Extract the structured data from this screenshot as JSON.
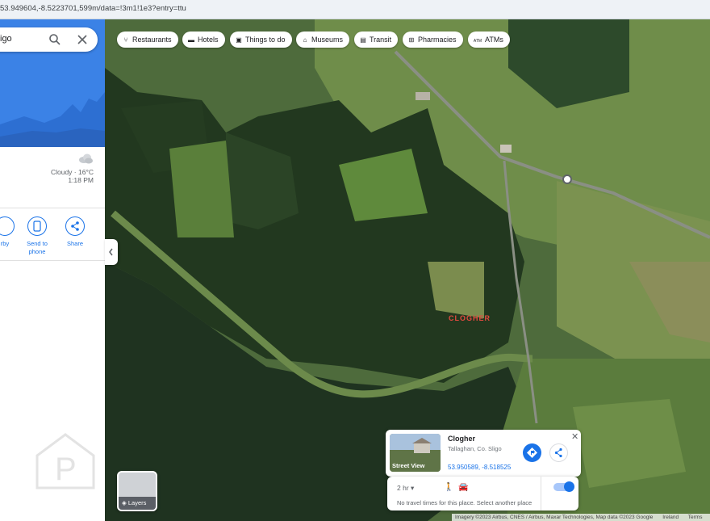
{
  "browser": {
    "url": "53.949604,-8.5223701,599m/data=!3m1!1e3?entry=ttu"
  },
  "panel": {
    "search_query": "igo",
    "weather": {
      "condition": "Cloudy",
      "temperature": "16°C",
      "time": "1:18 PM",
      "icon": "cloud-icon"
    },
    "actions": [
      {
        "label": "rby",
        "icon": "nearby-icon"
      },
      {
        "label": "Send to phone",
        "icon": "send-to-phone-icon"
      },
      {
        "label": "Share",
        "icon": "share-icon"
      }
    ]
  },
  "chips": [
    {
      "label": "Restaurants",
      "icon": "restaurant-icon"
    },
    {
      "label": "Hotels",
      "icon": "hotel-icon"
    },
    {
      "label": "Things to do",
      "icon": "camera-icon"
    },
    {
      "label": "Museums",
      "icon": "museum-icon"
    },
    {
      "label": "Transit",
      "icon": "transit-icon"
    },
    {
      "label": "Pharmacies",
      "icon": "pharmacy-icon"
    },
    {
      "label": "ATMs",
      "icon": "atm-icon"
    }
  ],
  "map": {
    "place_label": "CLOGHER",
    "layers_label": "Layers"
  },
  "card": {
    "title": "Clogher",
    "subtitle": "Tallaghan, Co. Sligo",
    "coords": "53.950589, -8.518525",
    "street_view": "Street View"
  },
  "travel": {
    "duration": "2 hr",
    "message": "No travel times for this place. Select another place"
  },
  "footer": {
    "attribution": "Imagery ©2023 Airbus, CNES / Airbus, Maxar Technologies, Map data ©2023 Google",
    "region": "Ireland",
    "terms": "Terms"
  },
  "colors": {
    "accent": "#1a73e8",
    "sky": "#3b82e6",
    "place_label": "#e54a3f"
  }
}
